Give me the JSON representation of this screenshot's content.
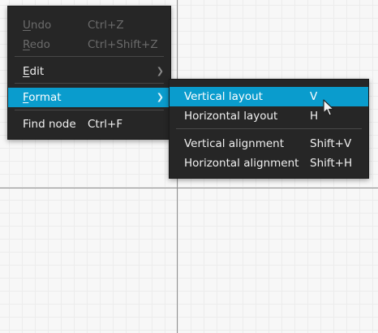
{
  "main_menu": {
    "items": [
      {
        "first": "U",
        "rest": "ndo",
        "shortcut": "Ctrl+Z",
        "enabled": false
      },
      {
        "first": "R",
        "rest": "edo",
        "shortcut": "Ctrl+Shift+Z",
        "enabled": false
      },
      {
        "first": "E",
        "rest": "dit",
        "shortcut": "",
        "enabled": true,
        "submenu": true
      },
      {
        "first": "F",
        "rest": "ormat",
        "shortcut": "",
        "enabled": true,
        "submenu": true,
        "highlighted": true
      },
      {
        "label": "Find node",
        "shortcut": "Ctrl+F",
        "enabled": true
      }
    ]
  },
  "format_submenu": {
    "items": [
      {
        "label": "Vertical layout",
        "shortcut": "V",
        "highlighted": true
      },
      {
        "label": "Horizontal layout",
        "shortcut": "H"
      },
      {
        "label": "Vertical alignment",
        "shortcut": "Shift+V"
      },
      {
        "label": "Horizontal alignment",
        "shortcut": "Shift+H"
      }
    ]
  },
  "icons": {
    "submenu_arrow": "chevron-right-icon",
    "cursor": "mouse-pointer-icon"
  },
  "colors": {
    "menu_bg": "#262626",
    "highlight": "#0a9ccd",
    "disabled_text": "#6b6b6b"
  }
}
